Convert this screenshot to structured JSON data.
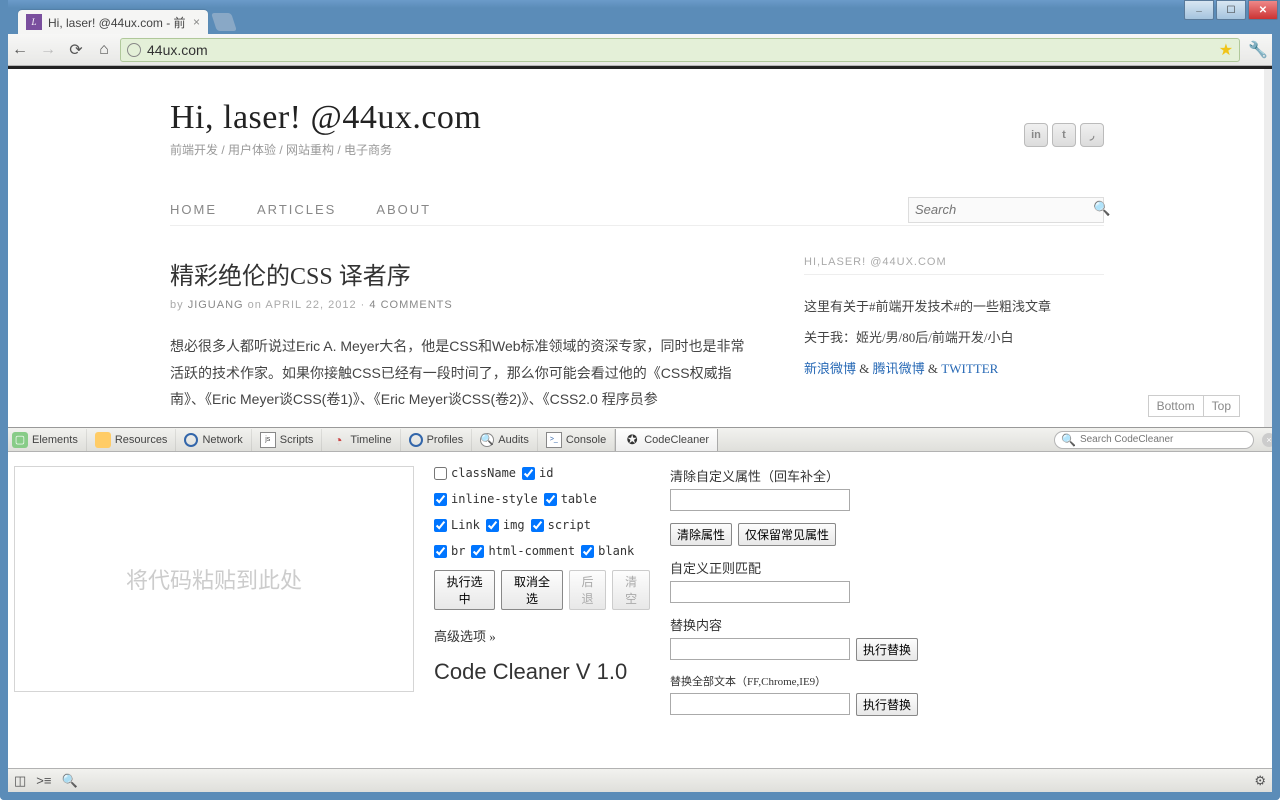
{
  "browser": {
    "tab_title": "Hi, laser! @44ux.com - 前",
    "url": "44ux.com"
  },
  "page": {
    "site_title": "Hi, laser! @44ux.com",
    "tagline": "前端开发 / 用户体验 / 网站重构 / 电子商务",
    "nav": {
      "home": "HOME",
      "articles": "ARTICLES",
      "about": "ABOUT"
    },
    "search_placeholder": "Search",
    "article": {
      "title": "精彩绝伦的CSS 译者序",
      "by": "by",
      "author": "JIGUANG",
      "on": "on",
      "date": "APRIL 22, 2012",
      "comments": "4 COMMENTS",
      "body": "想必很多人都听说过Eric A. Meyer大名，他是CSS和Web标准领域的资深专家，同时也是非常活跃的技术作家。如果你接触CSS已经有一段时间了，那么你可能会看过他的《CSS权威指南》、《Eric Meyer谈CSS(卷1)》、《Eric Meyer谈CSS(卷2)》、《CSS2.0 程序员参"
    },
    "sidebar": {
      "title": "HI,LASER! @44UX.COM",
      "line1": "这里有关于#前端开发技术#的一些粗浅文章",
      "line2": "关于我：姬光/男/80后/前端开发/小白",
      "link_sina": "新浪微博",
      "link_qq": "腾讯微博",
      "link_tw": "TWITTER",
      "amp": " & "
    },
    "float": {
      "bottom": "Bottom",
      "top": "Top"
    }
  },
  "devtools": {
    "tabs": {
      "elements": "Elements",
      "resources": "Resources",
      "network": "Network",
      "scripts": "Scripts",
      "timeline": "Timeline",
      "profiles": "Profiles",
      "audits": "Audits",
      "console": "Console",
      "codecleaner": "CodeCleaner"
    },
    "search_placeholder": "Search CodeCleaner",
    "paste_placeholder": "将代码粘贴到此处",
    "checks": {
      "className": "className",
      "id": "id",
      "inline_style": "inline-style",
      "table": "table",
      "link": "Link",
      "img": "img",
      "script": "script",
      "br": "br",
      "html_comment": "html-comment",
      "blank": "blank"
    },
    "buttons": {
      "exec_selected": "执行选中",
      "deselect_all": "取消全选",
      "back": "后退",
      "clear": "清空",
      "clear_attr": "清除属性",
      "keep_common": "仅保留常见属性",
      "exec_replace": "执行替换"
    },
    "advanced": "高级选项 »",
    "title": "Code Cleaner V 1.0",
    "col3": {
      "clear_custom_attr": "清除自定义属性（回车补全）",
      "custom_regex": "自定义正则匹配",
      "replace_content": "替换内容",
      "replace_all": "替换全部文本（FF,Chrome,IE9）"
    }
  }
}
